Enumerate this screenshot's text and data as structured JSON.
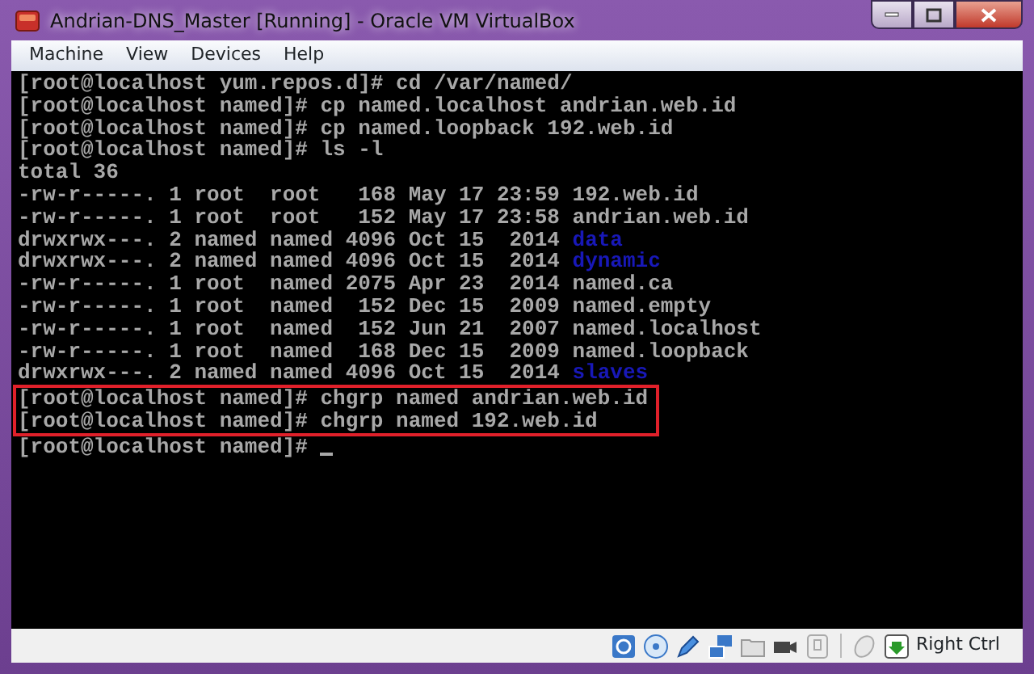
{
  "window": {
    "title": "Andrian-DNS_Master [Running] - Oracle VM VirtualBox"
  },
  "menu": [
    "Machine",
    "View",
    "Devices",
    "Help"
  ],
  "terminal": {
    "lines": [
      {
        "text": "[root@localhost yum.repos.d]# cd /var/named/",
        "highlighted": false
      },
      {
        "text": "[root@localhost named]# cp named.localhost andrian.web.id",
        "highlighted": false
      },
      {
        "text": "[root@localhost named]# cp named.loopback 192.web.id",
        "highlighted": false
      },
      {
        "text": "[root@localhost named]# ls -l",
        "highlighted": false
      },
      {
        "text": "total 36",
        "highlighted": false
      },
      {
        "text": "-rw-r-----. 1 root  root   168 May 17 23:59",
        "filename": "192.web.id",
        "kind": "file",
        "highlighted": false
      },
      {
        "text": "-rw-r-----. 1 root  root   152 May 17 23:58",
        "filename": "andrian.web.id",
        "kind": "file",
        "highlighted": false
      },
      {
        "text": "drwxrwx---. 2 named named 4096 Oct 15  2014",
        "filename": "data",
        "kind": "directory",
        "highlighted": false
      },
      {
        "text": "drwxrwx---. 2 named named 4096 Oct 15  2014",
        "filename": "dynamic",
        "kind": "directory",
        "highlighted": false
      },
      {
        "text": "-rw-r-----. 1 root  named 2075 Apr 23  2014",
        "filename": "named.ca",
        "kind": "file",
        "highlighted": false
      },
      {
        "text": "-rw-r-----. 1 root  named  152 Dec 15  2009",
        "filename": "named.empty",
        "kind": "file",
        "highlighted": false
      },
      {
        "text": "-rw-r-----. 1 root  named  152 Jun 21  2007",
        "filename": "named.localhost",
        "kind": "file",
        "highlighted": false
      },
      {
        "text": "-rw-r-----. 1 root  named  168 Dec 15  2009",
        "filename": "named.loopback",
        "kind": "file",
        "highlighted": false
      },
      {
        "text": "drwxrwx---. 2 named named 4096 Oct 15  2014",
        "filename": "slaves",
        "kind": "directory",
        "highlighted": false
      },
      {
        "text": "[root@localhost named]# chgrp named andrian.web.id",
        "highlighted": true
      },
      {
        "text": "[root@localhost named]# chgrp named 192.web.id",
        "highlighted": true
      },
      {
        "text": "[root@localhost named]#",
        "highlighted": false,
        "cursor": true
      }
    ]
  },
  "status_bar": {
    "host_key": "Right Ctrl"
  }
}
